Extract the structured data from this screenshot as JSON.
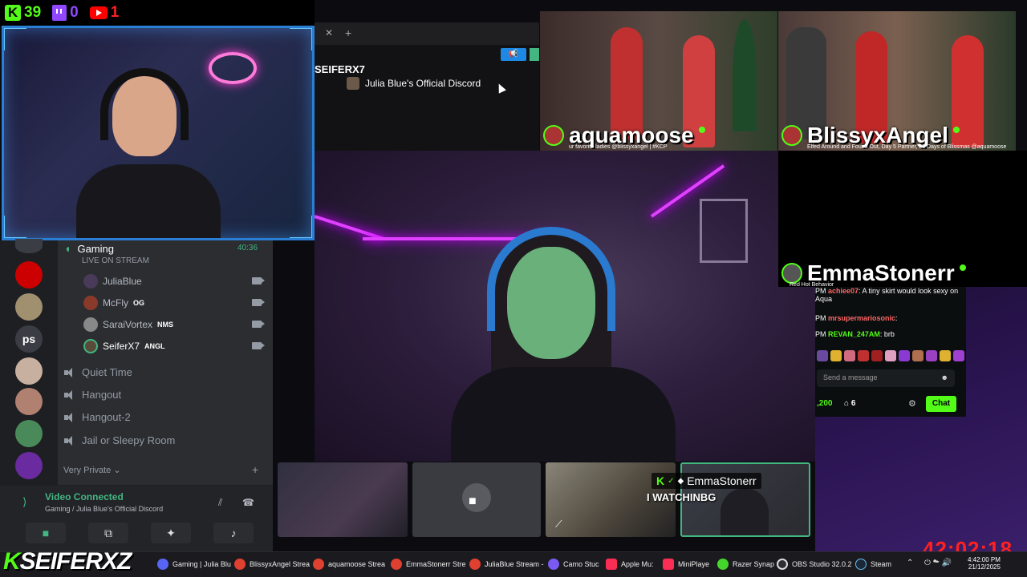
{
  "counters": {
    "kick": "39",
    "twitch": "0",
    "youtube": "1"
  },
  "browser": {
    "server_label": "SEIFERX7",
    "discord_title": "Julia Blue's Official Discord"
  },
  "guests": [
    {
      "name": "aquamoose",
      "caption": "ur favorite ladies @blissyxangel | #KCP"
    },
    {
      "name": "BlissyxAngel",
      "caption": "Elfed Around and Found Out, Day 5 Partner, 28 Days of Blissmas @aquamoose"
    },
    {
      "name": "EmmaStonerr",
      "caption": "Red Hot Behavior"
    }
  ],
  "discord": {
    "server_ps": "ps",
    "voice_channel": "Gaming",
    "voice_status": "LIVE ON STREAM",
    "voice_timer": "40:36",
    "users": [
      {
        "name": "JuliaBlue",
        "tag": ""
      },
      {
        "name": "McFly",
        "tag": "OG"
      },
      {
        "name": "SaraiVortex",
        "tag": "NMS"
      },
      {
        "name": "SeiferX7",
        "tag": "ANGL"
      }
    ],
    "channels": [
      "Quiet Time",
      "Hangout",
      "Hangout-2",
      "Jail or Sleepy Room"
    ],
    "category": "Very Private",
    "vc_title": "Video Connected",
    "vc_subtitle": "Gaming / Julia Blue's Official Discord"
  },
  "bottom": {
    "emma_label": "EmmaStonerr",
    "chat_overlay": "I WATCHINBG"
  },
  "kick_chat": {
    "lines": [
      {
        "prefix": "PM",
        "user": "achiee07",
        "text": ": A tiny skirt would look sexy on Aqua"
      },
      {
        "prefix": "PM",
        "user": "mrsupermariosonic",
        "text": ":"
      },
      {
        "prefix": "PM",
        "user": "REVAN_247AM",
        "text": ": brb"
      }
    ],
    "placeholder": "Send a message",
    "viewers": ",200",
    "count": "6",
    "chat_button": "Chat"
  },
  "timer": "42:02:18",
  "taskbar": {
    "brand_k": "K",
    "brand_rest": "SEIFERXZ",
    "items": [
      {
        "label": "Gaming | Julia Blu"
      },
      {
        "label": "BlissyxAngel Strea"
      },
      {
        "label": "aquamoose Strea"
      },
      {
        "label": "EmmaStonerr Stre"
      },
      {
        "label": "JuliaBlue Stream -"
      },
      {
        "label": "Camo Stuc"
      },
      {
        "label": "Apple Mu:"
      },
      {
        "label": "MiniPlaye"
      },
      {
        "label": "Razer Synap"
      },
      {
        "label": "OBS Studio 32.0.2"
      },
      {
        "label": "Steam"
      }
    ],
    "time": "4:42:00 PM",
    "date": "21/12/2025"
  },
  "colors": {
    "kick": "#53fc18",
    "twitch": "#9146ff",
    "youtube": "#ff0000",
    "discord_bg": "#2b2d31",
    "neon": "#e040ff"
  }
}
